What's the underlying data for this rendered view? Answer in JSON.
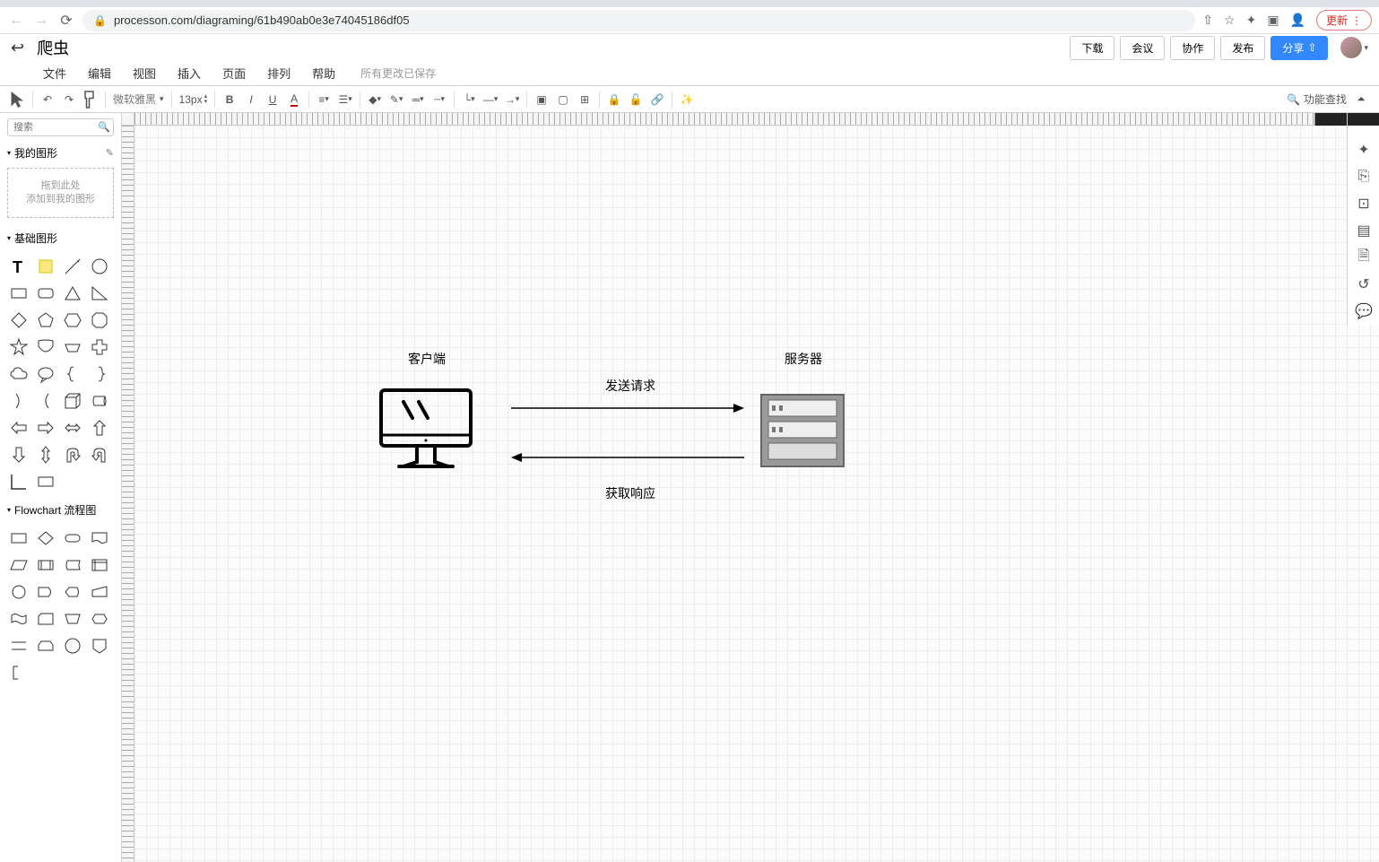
{
  "browser": {
    "url": "processon.com/diagraming/61b490ab0e3e74045186df05",
    "update_label": "更新"
  },
  "header": {
    "doc_title": "爬虫",
    "btn_download": "下载",
    "btn_meeting": "会议",
    "btn_collab": "协作",
    "btn_publish": "发布",
    "btn_share": "分享"
  },
  "menu": {
    "file": "文件",
    "edit": "编辑",
    "view": "视图",
    "insert": "插入",
    "page": "页面",
    "arrange": "排列",
    "help": "帮助",
    "save_status": "所有更改已保存"
  },
  "toolbar": {
    "font_name": "微软雅黑",
    "font_size": "13px",
    "search_feature": "功能查找"
  },
  "left": {
    "search_placeholder": "搜索",
    "my_shapes": "我的图形",
    "drop_line1": "拖到此处",
    "drop_line2": "添加到我的图形",
    "basic_shapes": "基础图形",
    "flowchart": "Flowchart 流程图"
  },
  "diagram": {
    "client": "客户端",
    "server": "服务器",
    "send_request": "发送请求",
    "get_response": "获取响应"
  }
}
